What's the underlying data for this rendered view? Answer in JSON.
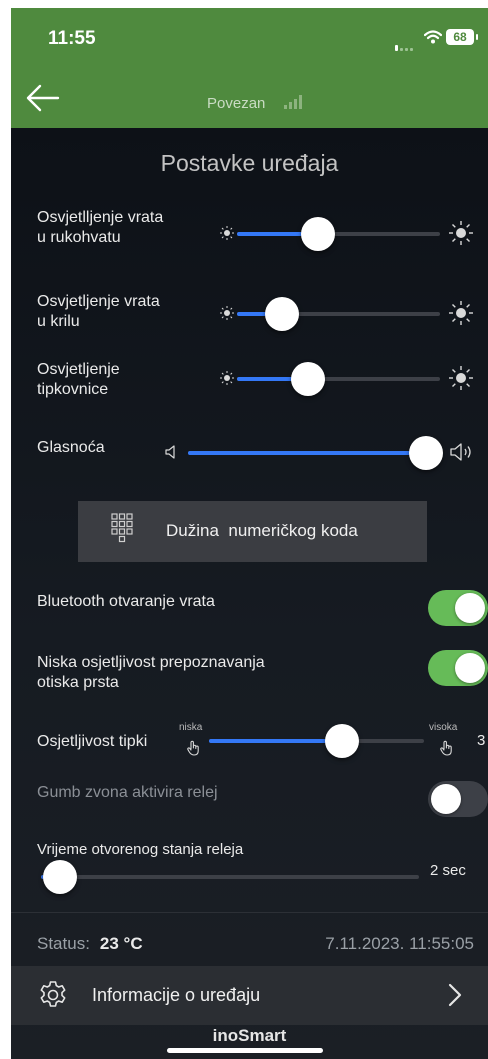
{
  "status_bar": {
    "time": "11:55",
    "battery": "68"
  },
  "app_bar": {
    "connection": "Povezan"
  },
  "page": {
    "title": "Postavke uređaja"
  },
  "sliders": [
    {
      "label": "Osvjetlljenje vrata\nu rukohvatu",
      "value": 0.4
    },
    {
      "label": "Osvjetljenje vrata\nu krilu",
      "value": 0.22
    },
    {
      "label": "Osvjetljenje\ntipkovnice",
      "value": 0.35
    }
  ],
  "volume": {
    "label": "Glasnoća",
    "value": 0.99
  },
  "code_button": {
    "label": "Dužina  numeričkog koda"
  },
  "toggles": [
    {
      "label": "Bluetooth otvaranje vrata",
      "on": true
    },
    {
      "label": "Niska osjetljivost prepoznavanja\notiska prsta",
      "on": true
    }
  ],
  "key_sensitivity": {
    "label": "Osjetljivost tipki",
    "low_label": "niska",
    "high_label": "visoka",
    "value": 0.62,
    "value_text": "3"
  },
  "doorbell_relay": {
    "label": "Gumb zvona aktivira relej",
    "on": false
  },
  "relay_time": {
    "label": "Vrijeme otvorenog stanja releja",
    "value": 0.05,
    "value_text": "2 sec"
  },
  "status": {
    "label": "Status:",
    "temperature": "23 °C",
    "datetime": "7.11.2023. 11:55:05"
  },
  "info_row": {
    "label": "Informacije o uređaju"
  },
  "footer": {
    "brand": "inoSmart"
  },
  "colors": {
    "header_green": "#4f8a3e",
    "accent_blue": "#3478f6",
    "toggle_green": "#66bb58"
  }
}
